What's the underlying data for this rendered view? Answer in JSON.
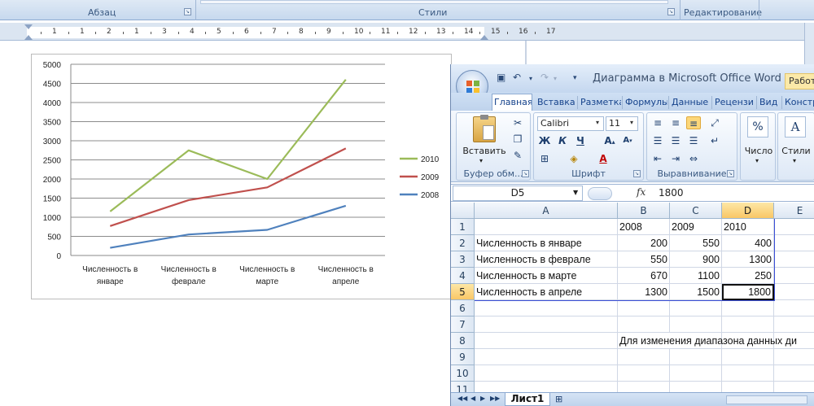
{
  "word": {
    "ribbon": {
      "groups": [
        {
          "label": "Абзац"
        },
        {
          "label": "Стили"
        },
        {
          "label": "Редактирование"
        }
      ]
    },
    "ruler": {
      "numbers": [
        "1",
        "1",
        "2",
        "1",
        "3",
        "4",
        "5",
        "6",
        "7",
        "8",
        "9",
        "10",
        "11",
        "12",
        "13",
        "14",
        "15",
        "16",
        "17"
      ]
    }
  },
  "chart_data": {
    "type": "line",
    "categories": [
      "Численность в январе",
      "Численность в феврале",
      "Численность в марте",
      "Численность в апреле"
    ],
    "series": [
      {
        "name": "2010",
        "values": [
          1150,
          2750,
          2000,
          4600
        ],
        "color": "#9bbb59"
      },
      {
        "name": "2009",
        "values": [
          770,
          1450,
          1780,
          2800
        ],
        "color": "#c0504d"
      },
      {
        "name": "2008",
        "values": [
          200,
          550,
          670,
          1300
        ],
        "color": "#4f81bd"
      }
    ],
    "ylim": [
      0,
      5000
    ],
    "yticks": [
      "0",
      "500",
      "1000",
      "1500",
      "2000",
      "2500",
      "3000",
      "3500",
      "4000",
      "4500",
      "5000"
    ],
    "grid": true,
    "legend_position": "right"
  },
  "excel": {
    "title": "Диаграмма в Microsoft Office Word",
    "context_tab": "Работа",
    "tabs": [
      "Главная",
      "Вставка",
      "Разметка",
      "Формулы",
      "Данные",
      "Рецензи",
      "Вид",
      "Констр"
    ],
    "ribbon": {
      "paste_label": "Вставить",
      "clipboard_label": "Буфер обм...",
      "font_name": "Calibri",
      "font_size": "11",
      "font_group_label": "Шрифт",
      "bold": "Ж",
      "italic": "К",
      "underline": "Ч",
      "align_group_label": "Выравнивание",
      "number_label": "Число",
      "number_symbol": "%",
      "styles_label": "Стили"
    },
    "name_box": "D5",
    "fx": "fx",
    "formula_value": "1800",
    "columns": [
      "A",
      "B",
      "C",
      "D",
      "E"
    ],
    "rows": [
      {
        "n": "1",
        "a": "",
        "b": "2008",
        "c": "2009",
        "d": "2010"
      },
      {
        "n": "2",
        "a": "Численность в январе",
        "b": "200",
        "c": "550",
        "d": "400"
      },
      {
        "n": "3",
        "a": "Численность в феврале",
        "b": "550",
        "c": "900",
        "d": "1300"
      },
      {
        "n": "4",
        "a": "Численность в марте",
        "b": "670",
        "c": "1100",
        "d": "250"
      },
      {
        "n": "5",
        "a": "Численность в апреле",
        "b": "1300",
        "c": "1500",
        "d": "1800"
      },
      {
        "n": "6",
        "a": "",
        "b": "",
        "c": "",
        "d": ""
      },
      {
        "n": "7",
        "a": "",
        "b": "",
        "c": "",
        "d": ""
      },
      {
        "n": "8",
        "a": "",
        "b": "Для изменения диапазона данных ди",
        "c": "",
        "d": ""
      },
      {
        "n": "9",
        "a": "",
        "b": "",
        "c": "",
        "d": ""
      },
      {
        "n": "10",
        "a": "",
        "b": "",
        "c": "",
        "d": ""
      },
      {
        "n": "11",
        "a": "",
        "b": "",
        "c": "",
        "d": ""
      }
    ],
    "sheet_tab": "Лист1"
  }
}
